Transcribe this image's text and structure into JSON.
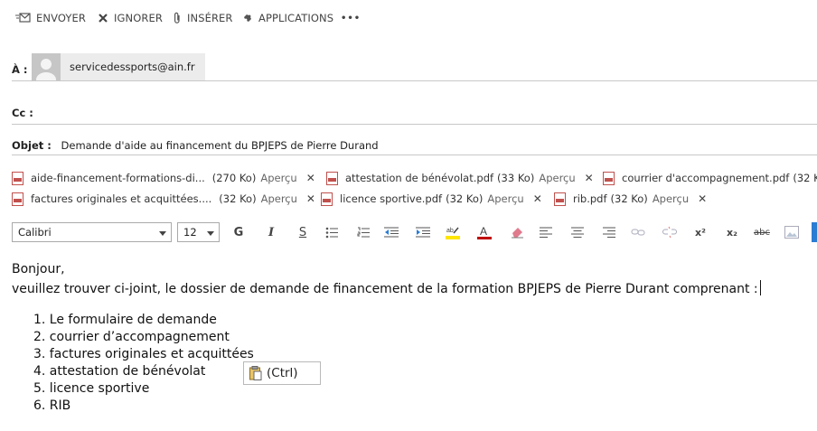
{
  "toolbar": {
    "send": "ENVOYER",
    "ignore": "IGNORER",
    "insert": "INSÉRER",
    "apps": "APPLICATIONS",
    "more": "•••"
  },
  "to": {
    "label": "À :",
    "recipient": "servicedessports@ain.fr"
  },
  "cc": {
    "label": "Cc :"
  },
  "subject": {
    "label": "Objet :",
    "value": "Demande d'aide au financement du BPJEPS de Pierre Durand"
  },
  "attachments": {
    "preview_label": "Aperçu",
    "items": [
      {
        "name": "aide-financement-formations-di...",
        "size": "(270 Ko)"
      },
      {
        "name": "attestation de bénévolat.pdf",
        "size": "(33 Ko)"
      },
      {
        "name": "courrier d'accompagnement.pdf",
        "size": "(32 Ko)"
      },
      {
        "name": "factures originales et acquittées....",
        "size": "(32 Ko)"
      },
      {
        "name": "licence sportive.pdf",
        "size": "(32 Ko)"
      },
      {
        "name": "rib.pdf",
        "size": "(32 Ko)"
      }
    ]
  },
  "format": {
    "font": "Calibri",
    "size": "12",
    "bold": "G",
    "italic": "I",
    "underline": "S",
    "superscript": "x²",
    "subscript": "x₂",
    "strike": "abc"
  },
  "message": {
    "greeting": "Bonjour,",
    "intro": "veuillez trouver ci-joint, le dossier de demande de financement de la formation BPJEPS de Pierre Durant comprenant :",
    "items": [
      "1. Le formulaire de demande",
      "2. courrier d’accompagnement",
      "3. factures originales et acquittées",
      "4. attestation de bénévolat",
      "5. licence sportive",
      "6. RIB"
    ]
  },
  "paste_options": {
    "label": "(Ctrl)"
  },
  "colors": {
    "accent": "#2b7cd3",
    "font_color": "#c00000",
    "highlight": "#ffe600"
  }
}
